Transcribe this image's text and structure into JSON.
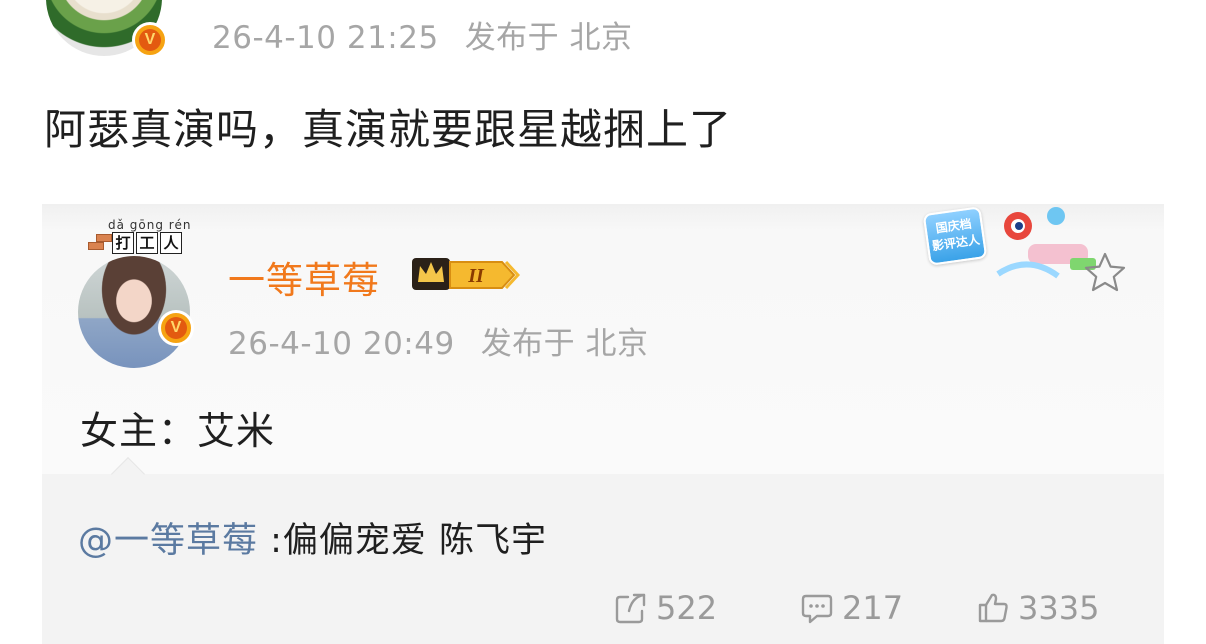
{
  "post": {
    "timestamp": "26-4-10 21:25",
    "location_prefix": "发布于",
    "location": "北京",
    "text": "阿瑟真演吗，真演就要跟星越捆上了",
    "verified_badge": "V"
  },
  "repost": {
    "pinyin": "dǎ gōng rén",
    "title_badge_chars": [
      "打",
      "工",
      "人"
    ],
    "author": "一等草莓",
    "level_badge": "II",
    "timestamp": "26-4-10 20:49",
    "location_prefix": "发布于",
    "location": "北京",
    "text": "女主：艾米",
    "sticker_text": "国庆档\n影评达人",
    "verified_badge": "V",
    "mention": "@一等草莓",
    "mention_text": " :偏偏宠爱 陈飞宇",
    "actions": {
      "repost_count": "522",
      "comment_count": "217",
      "like_count": "3335"
    }
  },
  "icons": {
    "repost": "repost-icon",
    "comment": "comment-icon",
    "like": "thumbs-up-icon",
    "favorite": "star-icon"
  },
  "colors": {
    "author_name": "#f1791c",
    "mention": "#5b7aa1",
    "meta": "#a6a6a6",
    "badge": "#f6a312"
  }
}
